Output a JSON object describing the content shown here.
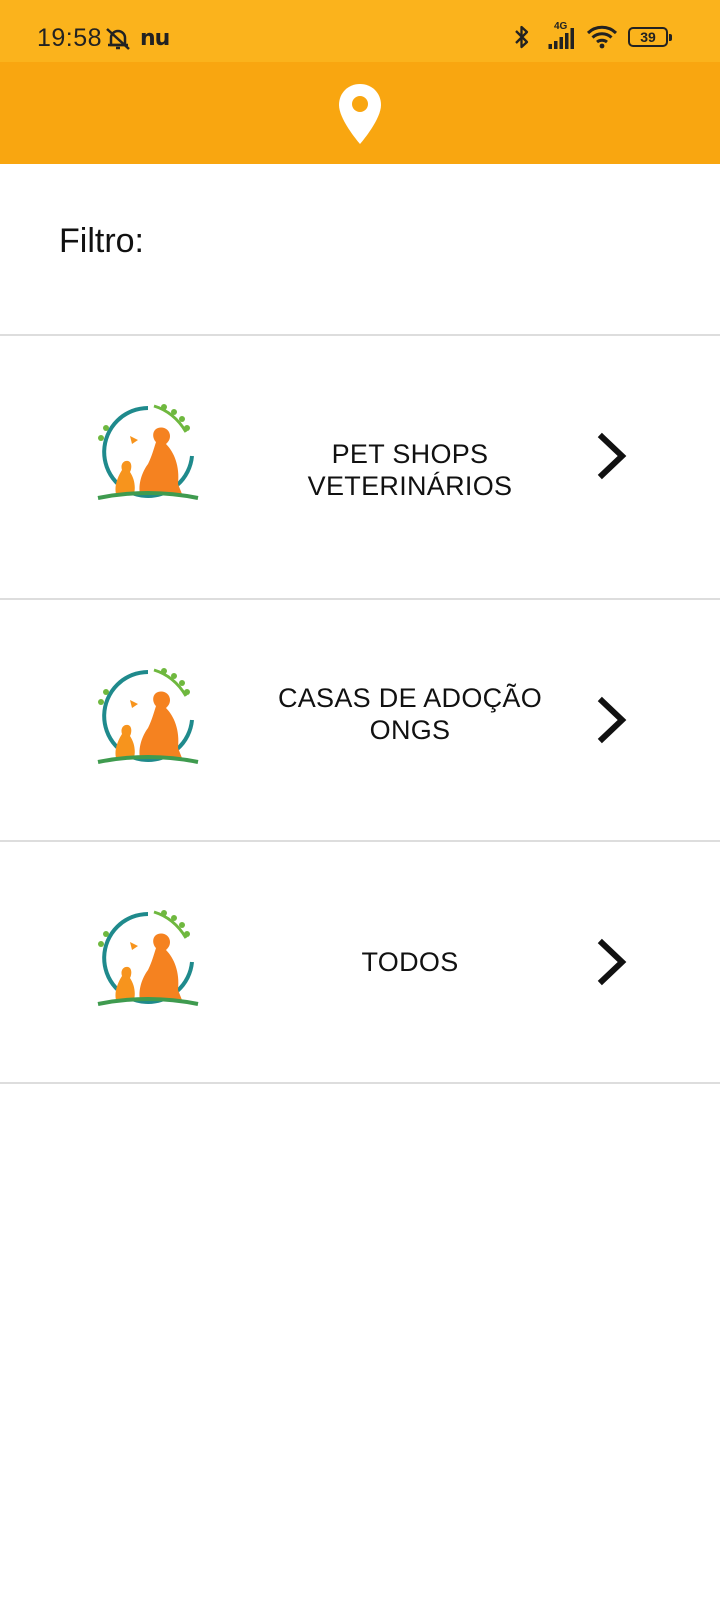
{
  "status_bar": {
    "time": "19:58",
    "carrier_icon": "nu",
    "network": "4G",
    "battery": "39",
    "icons": [
      "alarm-off-icon",
      "bluetooth-icon",
      "signal-icon",
      "wifi-icon",
      "battery-icon"
    ]
  },
  "app_bar": {
    "icon": "location-pin-icon"
  },
  "filter": {
    "label": "Filtro:"
  },
  "categories": [
    {
      "line1": "PET SHOPS",
      "line2": "VETERINÁRIOS"
    },
    {
      "line1": "CASAS DE ADOÇÃO",
      "line2": "ONGS"
    },
    {
      "line1": "TODOS",
      "line2": ""
    }
  ],
  "colors": {
    "status_bar": "#fbb31c",
    "app_bar": "#f9a610",
    "logo_orange": "#f58220",
    "logo_teal": "#1f8a8c",
    "logo_green": "#6fb83f"
  }
}
